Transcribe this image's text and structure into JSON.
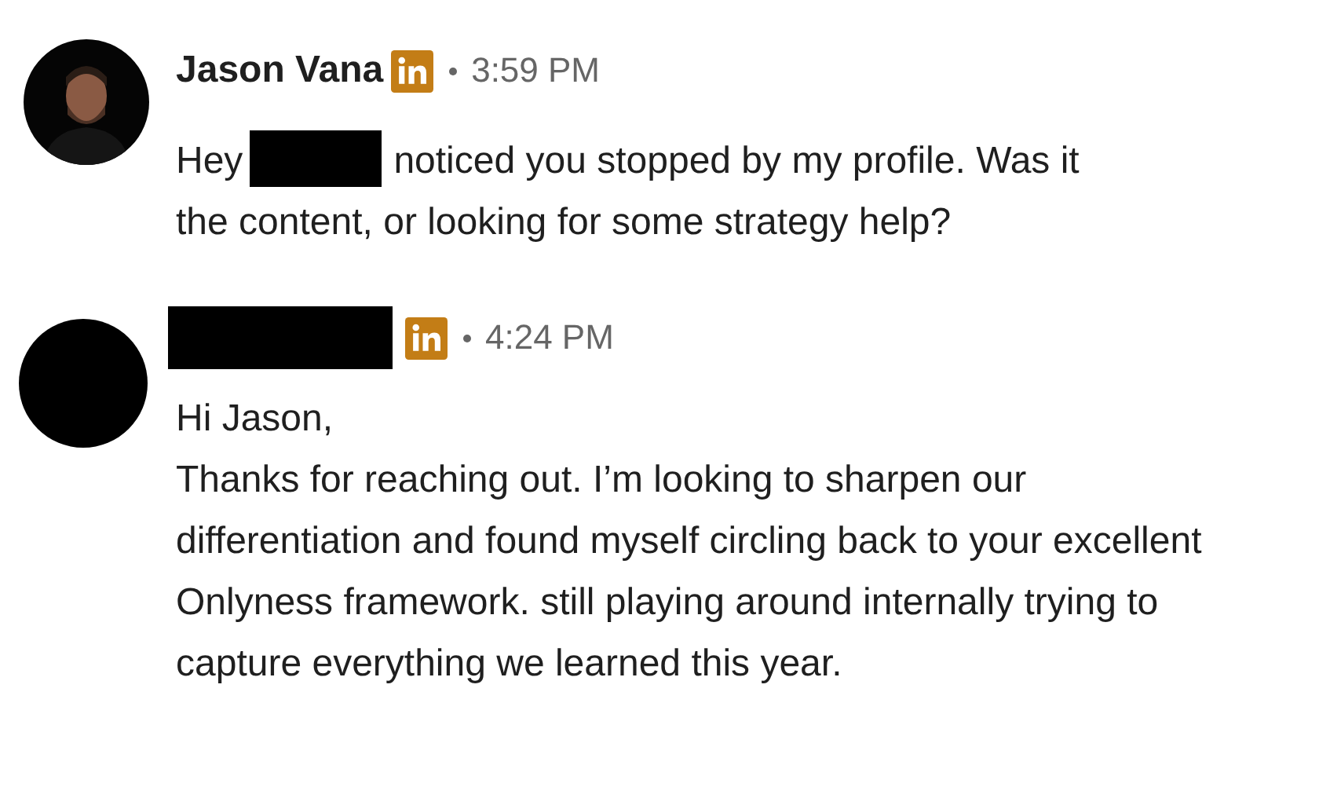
{
  "messages": [
    {
      "sender": {
        "kind": "name",
        "text": "Jason Vana"
      },
      "time": "3:59 PM",
      "body": [
        {
          "kind": "text",
          "text": "Hey"
        },
        {
          "kind": "redacted"
        },
        {
          "kind": "text",
          "text": "noticed you stopped by my profile. Was it"
        },
        {
          "kind": "break"
        },
        {
          "kind": "text",
          "text": "the content, or looking for some strategy help?"
        }
      ]
    },
    {
      "avatar": {
        "kind": "blank"
      },
      "sender": {
        "kind": "redacted"
      },
      "time": "4:24 PM",
      "body": [
        {
          "kind": "text",
          "text": "Hi Jason,"
        },
        {
          "kind": "break"
        },
        {
          "kind": "text",
          "text": "Thanks for reaching out. I’m looking to sharpen our differentiation and found myself circling back to your excellent Onlyness framework. still playing around internally trying to capture everything we learned this year."
        }
      ]
    }
  ]
}
